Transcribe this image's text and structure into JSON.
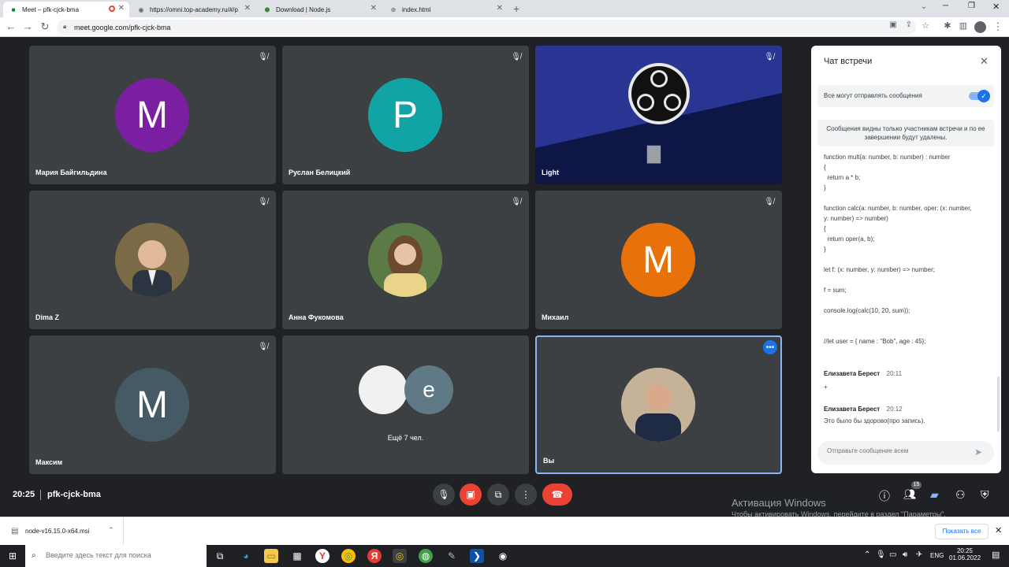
{
  "browser": {
    "tabs": [
      {
        "title": "Meet – pfk-cjck-bma",
        "active": true
      },
      {
        "title": "https://omni.top-academy.ru/#/p",
        "active": false
      },
      {
        "title": "Download | Node.js",
        "active": false
      },
      {
        "title": "index.html",
        "active": false
      }
    ],
    "url": "meet.google.com/pfk-cjck-bma"
  },
  "tiles": [
    {
      "name": "Мария Байгильдина",
      "initial": "M",
      "color": "#7b1fa2",
      "muted": true
    },
    {
      "name": "Руслан Белицкий",
      "initial": "P",
      "color": "#12a4a4",
      "muted": true
    },
    {
      "name": "Light",
      "muted": true
    },
    {
      "name": "Dima Z",
      "muted": true
    },
    {
      "name": "Анна Фукомова",
      "muted": true
    },
    {
      "name": "Михаил",
      "initial": "M",
      "color": "#e8710a",
      "muted": true
    },
    {
      "name": "Максим",
      "initial": "M",
      "color": "#455a64",
      "muted": true
    },
    {
      "name": "",
      "more_label": "Ещё 7 чел.",
      "initial": "e"
    },
    {
      "name": "Вы",
      "muted": false
    }
  ],
  "chat": {
    "title": "Чат встречи",
    "toggle_label": "Все могут отправлять сообщения",
    "toggle_on": true,
    "notice": "Сообщения видны только участникам встречи и по ее завершении будут удалены.",
    "code_lines": [
      "function mult(a: number, b: number) : number",
      "{",
      "  return a * b;",
      "}",
      "",
      "function calc(a: number, b: number, oper: (x: number,",
      "y: number) => number)",
      "{",
      "  return oper(a, b);",
      "}",
      "",
      "let f: (x: number, y: number) => number;",
      "",
      "f = sum;",
      "",
      "console.log(calc(10, 20, sum));",
      "",
      "",
      "//let user = { name : \"Bob\", age : 45};"
    ],
    "messages": [
      {
        "author": "Елизавета Берест",
        "time": "20:11",
        "text": "+"
      },
      {
        "author": "Елизавета Берест",
        "time": "20:12",
        "text": "Это было бы здорово(про запись)."
      }
    ],
    "input_placeholder": "Отправьте сообщение всем"
  },
  "meeting": {
    "time": "20:25",
    "code": "pfk-cjck-bma",
    "participants_badge": "15"
  },
  "watermark": {
    "title": "Активация Windows",
    "subtitle": "Чтобы активировать Windows, перейдите в раздел \"Параметры\"."
  },
  "download": {
    "file": "node-v16.15.0-x64.msi",
    "show_all": "Показать все"
  },
  "taskbar": {
    "search_placeholder": "Введите здесь текст для поиска",
    "lang": "ENG",
    "clock_time": "20:25",
    "clock_date": "01.06.2022"
  },
  "colors": {
    "accent": "#1a73e8",
    "end_call": "#ea4335",
    "meet_bg": "#202124",
    "tile_bg": "#3c4043"
  }
}
